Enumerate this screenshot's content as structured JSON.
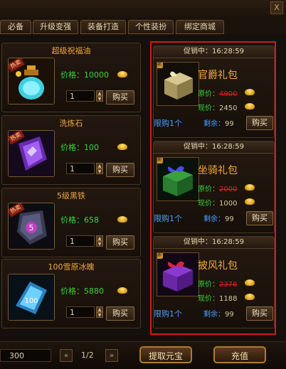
{
  "window": {
    "close_label": "X"
  },
  "tabs": [
    {
      "label": "必备"
    },
    {
      "label": "升级变强"
    },
    {
      "label": "装备打造"
    },
    {
      "label": "个性装扮"
    },
    {
      "label": "绑定商城"
    }
  ],
  "shop_items": [
    {
      "name": "超级祝福油",
      "hot": "热卖",
      "price_label": "价格：",
      "price": "10000",
      "qty": "1",
      "buy": "购买"
    },
    {
      "name": "洗炼石",
      "hot": "热卖",
      "price_label": "价格：",
      "price": "100",
      "qty": "1",
      "buy": "购买"
    },
    {
      "name": "5级黑铁",
      "hot": "热卖",
      "price_label": "价格：",
      "price": "658",
      "qty": "1",
      "buy": "购买"
    },
    {
      "name": "100雪原冰魄",
      "hot": "",
      "price_label": "价格：",
      "price": "5880",
      "qty": "1",
      "buy": "购买"
    }
  ],
  "promos": [
    {
      "header": "促销中：16:28:59",
      "tag": "绑",
      "name": "官爵礼包",
      "orig_label": "原价：",
      "orig": "4900",
      "curr_label": "现价：",
      "curr": "2450",
      "limit": "限购1个",
      "remain_label": "剩余：",
      "remain": "99",
      "buy": "购买"
    },
    {
      "header": "促销中：16:28:59",
      "tag": "绑",
      "name": "坐骑礼包",
      "orig_label": "原价：",
      "orig": "2000",
      "curr_label": "现价：",
      "curr": "1000",
      "limit": "限购1个",
      "remain_label": "剩余：",
      "remain": "99",
      "buy": "购买"
    },
    {
      "header": "促销中：16:28:59",
      "tag": "绑",
      "name": "披风礼包",
      "orig_label": "原价：",
      "orig": "2376",
      "curr_label": "现价：",
      "curr": "1188",
      "limit": "限购1个",
      "remain_label": "剩余：",
      "remain": "99",
      "buy": "购买"
    }
  ],
  "footer": {
    "balance": "300",
    "prev": "«",
    "next": "»",
    "page": "1/2",
    "withdraw": "提取元宝",
    "recharge": "充值"
  },
  "colors": {
    "accent": "#f0a83c",
    "highlight_border": "#d61a10",
    "price_green": "#3cd23c"
  }
}
